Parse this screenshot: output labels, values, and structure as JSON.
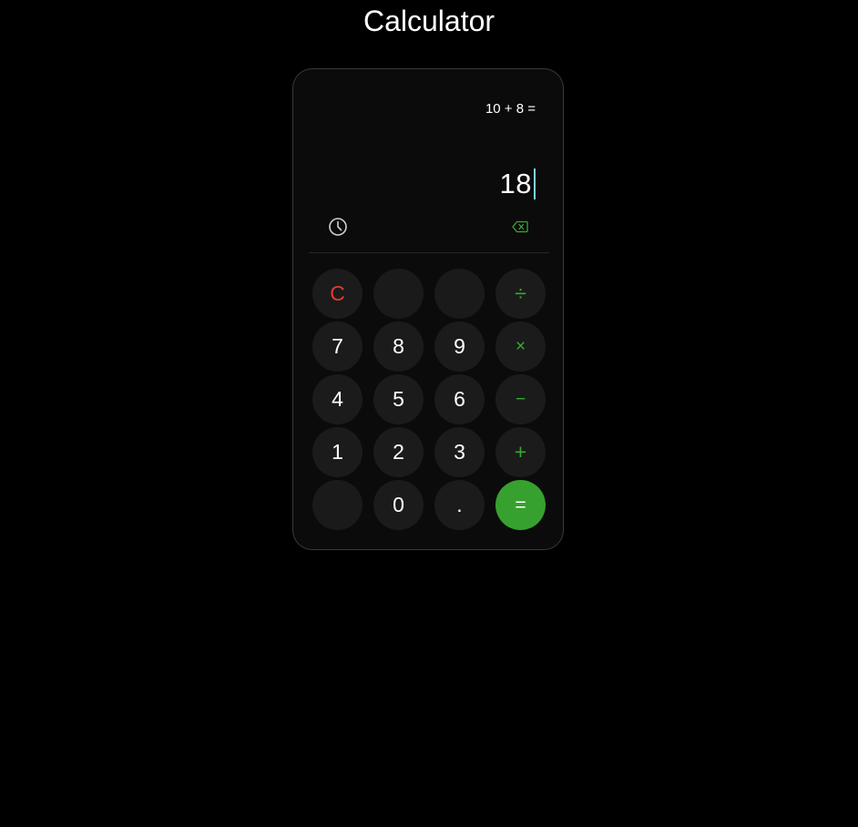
{
  "page": {
    "title": "Calculator"
  },
  "display": {
    "expression": "10 + 8 =",
    "result": "18"
  },
  "keys": {
    "clear": "C",
    "divide": "÷",
    "seven": "7",
    "eight": "8",
    "nine": "9",
    "multiply": "×",
    "four": "4",
    "five": "5",
    "six": "6",
    "subtract": "−",
    "one": "1",
    "two": "2",
    "three": "3",
    "add": "+",
    "zero": "0",
    "decimal": ".",
    "equals": "="
  },
  "icons": {
    "history": "clock-icon",
    "backspace": "backspace-icon"
  },
  "colors": {
    "background": "#000000",
    "panel": "#0b0b0b",
    "key": "#1b1b1b",
    "accent_green": "#37a12f",
    "clear_red": "#e23b2e",
    "cursor": "#7fd3ea"
  }
}
